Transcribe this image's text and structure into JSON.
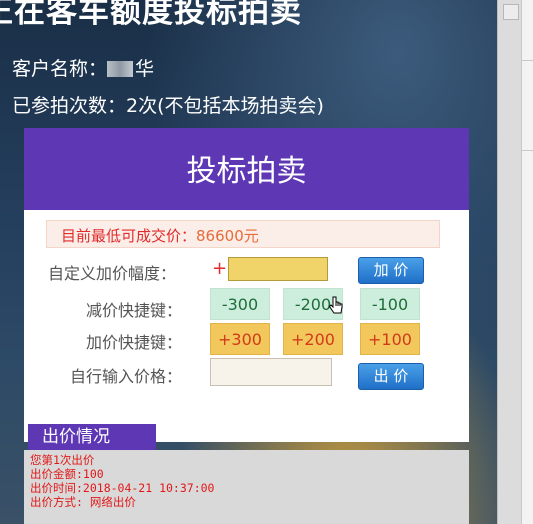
{
  "page": {
    "heading": "正在客车额度投标拍卖",
    "client_label": "客户名称：",
    "client_name_visible": "华",
    "bid_count_line": "已参拍次数：2次(不包括本场拍卖会)"
  },
  "modal": {
    "title": "投标拍卖",
    "lowest_price_label": "目前最低可成交价：",
    "lowest_price_value": "86600元",
    "custom_increment_label": "自定义加价幅度：",
    "plus_sign": "+",
    "add_price_button": "加 价",
    "decrease_shortcut_label": "减价快捷键：",
    "increase_shortcut_label": "加价快捷键：",
    "decrease_buttons": [
      "-300",
      "-200",
      "-100"
    ],
    "increase_buttons": [
      "+300",
      "+200",
      "+100"
    ],
    "manual_price_label": "自行输入价格：",
    "bid_button": "出 价"
  },
  "history": {
    "tab_label": "出价情况",
    "lines": [
      "您第1次出价",
      "出价金额:100",
      "出价时间:2018-04-21 10:37:00",
      "出价方式: 网络出价"
    ]
  },
  "colors": {
    "purple": "#5d37b4",
    "price_red": "#e22a2a",
    "minus_green": "#cdeedd",
    "plus_yellow": "#f2c85c",
    "button_blue": "#1f6fc8"
  }
}
